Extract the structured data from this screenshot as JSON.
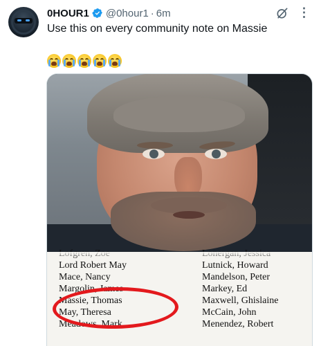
{
  "tweet": {
    "display_name": "0HOUR1",
    "handle": "@0hour1",
    "separator": "·",
    "timestamp": "6m",
    "text": "Use this on every community note on Massie",
    "emojis": [
      "loudly-crying-face",
      "loudly-crying-face",
      "loudly-crying-face",
      "loudly-crying-face",
      "loudly-crying-face"
    ],
    "more_label": "⋮"
  },
  "icons": {
    "verified": "verified-badge-icon",
    "grok": "grok-icon",
    "more": "more-options-icon"
  },
  "colors": {
    "verified": "#1d9bf0",
    "text": "#0f1419",
    "muted": "#536471",
    "highlight_circle": "#e3191d"
  },
  "document": {
    "left_column": [
      "Lofgren, Zoe",
      "Lord Robert May",
      "Mace, Nancy",
      "Margolin, James",
      "Massie, Thomas",
      "May, Theresa",
      "Meadows, Mark"
    ],
    "right_column": [
      "Lonergan, Jessica",
      "Lutnick, Howard",
      "Mandelson, Peter",
      "Markey, Ed",
      "Maxwell, Ghislaine",
      "McCain, John",
      "Menendez, Robert"
    ]
  }
}
